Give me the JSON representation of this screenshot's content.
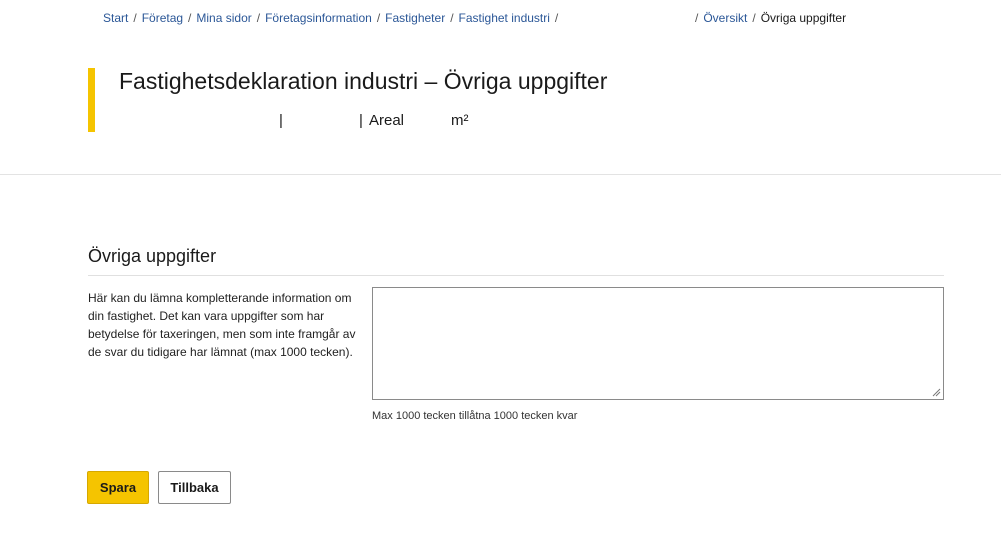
{
  "breadcrumb": {
    "items": [
      {
        "label": "Start"
      },
      {
        "label": "Företag"
      },
      {
        "label": "Mina sidor"
      },
      {
        "label": "Företagsinformation"
      },
      {
        "label": "Fastigheter"
      },
      {
        "label": "Fastighet industri"
      }
    ],
    "separator": "/",
    "tail_link": "Översikt",
    "current": "Övriga uppgifter"
  },
  "header": {
    "title": "Fastighetsdeklaration industri – Övriga uppgifter",
    "subline": {
      "pipe": "|",
      "areal_label": "Areal",
      "unit": "m²"
    },
    "accent_color": "#f5c400"
  },
  "section": {
    "heading": "Övriga uppgifter",
    "help_text": "Här kan du lämna kompletterande information om din fastighet. Det kan vara uppgifter som har betydelse för taxeringen, men som inte framgår av de svar du tidigare har lämnat (max 1000 tecken).",
    "textarea_value": "",
    "counter_text": "Max 1000 tecken tillåtna  1000 tecken kvar"
  },
  "actions": {
    "save_label": "Spara",
    "back_label": "Tillbaka"
  }
}
